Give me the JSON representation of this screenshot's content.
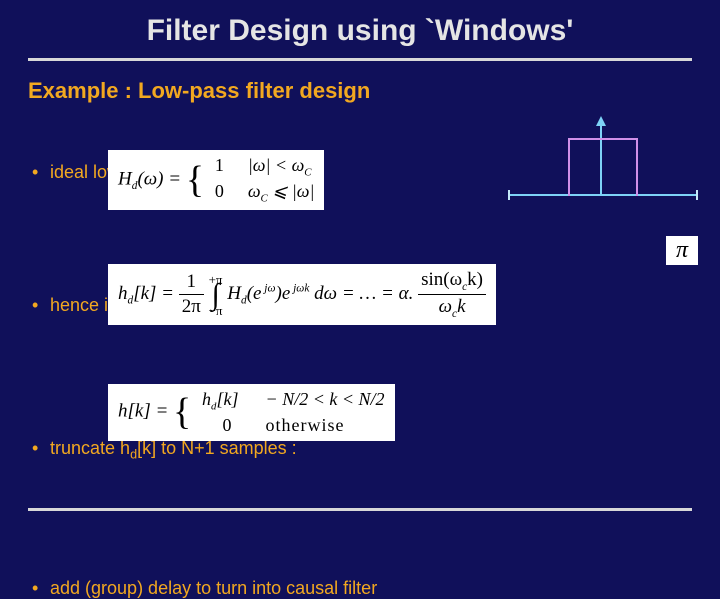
{
  "title": "Filter Design using `Windows'",
  "example_heading": "Example : Low-pass filter design",
  "bullets": {
    "b1": "ideal low-pass filter is",
    "b2": "hence ideal time-domain impulse response is",
    "b3_pre": "truncate h",
    "b3_sub": "d",
    "b3_post": "[k] to N+1 samples :",
    "b4": "add (group) delay to turn into causal filter"
  },
  "eq1": {
    "lhs_H": "H",
    "lhs_sub": "d",
    "lhs_arg": "(ω) =",
    "case1_val": "1",
    "case1_cond": "|ω| < ω",
    "case1_cond_sub": "C",
    "case2_val": "0",
    "case2_cond_pre": "ω",
    "case2_cond_sub": "C",
    "case2_cond_post": " ⩽ |ω|"
  },
  "eq2": {
    "lhs_h": "h",
    "lhs_sub": "d",
    "lhs_arg": "[k] =",
    "frac1_num": "1",
    "frac1_den": "2π",
    "int_upper": "+π",
    "int_lower": "−π",
    "integrand_H": "H",
    "integrand_sub": "d",
    "integrand_arg1": "(e",
    "integrand_exp1": " jω",
    "integrand_arg1b": ")",
    "integrand_e2": "e",
    "integrand_exp2": " jωk",
    "dw": " dω = … = α.",
    "frac2_num_pre": "sin(ω",
    "frac2_num_sub": "c",
    "frac2_num_post": "k)",
    "frac2_den_pre": "ω",
    "frac2_den_sub": "c",
    "frac2_den_post": "k"
  },
  "eq3": {
    "lhs": "h[k] =",
    "case1_val_h": "h",
    "case1_val_sub": "d",
    "case1_val_arg": "[k]",
    "case1_cond": "− N/2 < k < N/2",
    "case2_val": "0",
    "case2_cond": "otherwise"
  },
  "pi": "π"
}
